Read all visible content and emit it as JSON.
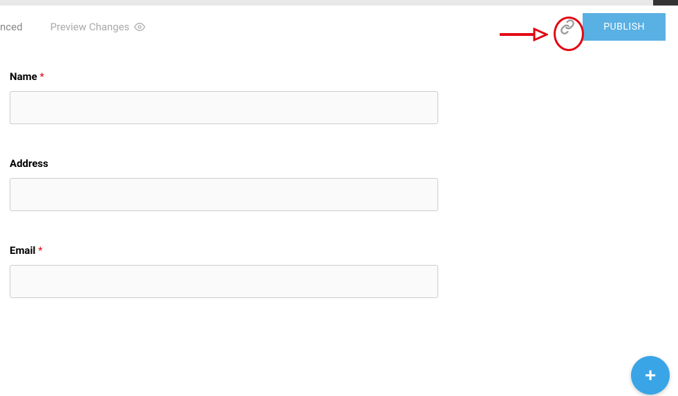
{
  "header": {
    "partial_text": "nced",
    "preview_label": "Preview Changes",
    "publish_label": "PUBLISH"
  },
  "form": {
    "fields": [
      {
        "label": "Name",
        "required": true,
        "value": ""
      },
      {
        "label": "Address",
        "required": false,
        "value": ""
      },
      {
        "label": "Email",
        "required": true,
        "value": ""
      }
    ]
  },
  "fab": {
    "symbol": "+"
  }
}
